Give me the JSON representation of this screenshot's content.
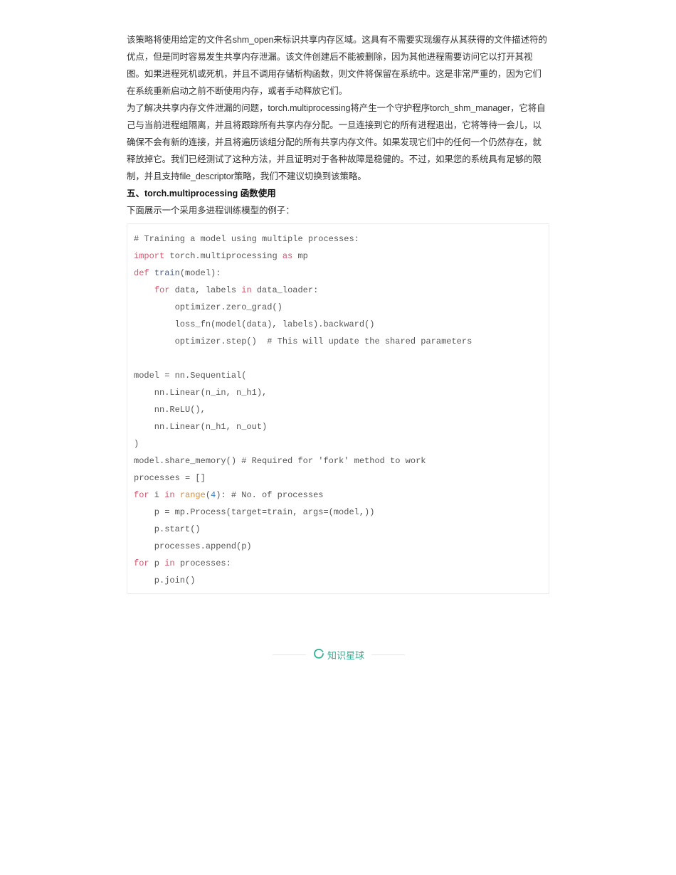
{
  "paragraphs": [
    "该策略将使用给定的文件名shm_open来标识共享内存区域。这具有不需要实现缓存从其获得的文件描述符的优点，但是同时容易发生共享内存泄漏。该文件创建后不能被删除，因为其他进程需要访问它以打开其视图。如果进程死机或死机，并且不调用存储析构函数，则文件将保留在系统中。这是非常严重的，因为它们在系统重新启动之前不断使用内存，或者手动释放它们。",
    "为了解决共享内存文件泄漏的问题，torch.multiprocessing将产生一个守护程序torch_shm_manager，它将自己与当前进程组隔离，并且将跟踪所有共享内存分配。一旦连接到它的所有进程退出，它将等待一会儿，以确保不会有新的连接，并且将遍历该组分配的所有共享内存文件。如果发现它们中的任何一个仍然存在，就释放掉它。我们已经测试了这种方法，并且证明对于各种故障是稳健的。不过，如果您的系统具有足够的限制，并且支持file_descriptor策略，我们不建议切换到该策略。"
  ],
  "section_heading": "五、torch.multiprocessing 函数使用",
  "intro_text": "下面展示一个采用多进程训练模型的例子：",
  "code": {
    "lines": [
      [
        {
          "t": "plain",
          "v": "# Training a model using multiple processes:"
        }
      ],
      [
        {
          "t": "kw",
          "v": "import"
        },
        {
          "t": "plain",
          "v": " torch.multiprocessing "
        },
        {
          "t": "kw",
          "v": "as"
        },
        {
          "t": "plain",
          "v": " mp"
        }
      ],
      [
        {
          "t": "kw",
          "v": "def"
        },
        {
          "t": "plain",
          "v": " "
        },
        {
          "t": "fn",
          "v": "train"
        },
        {
          "t": "plain",
          "v": "(model):"
        }
      ],
      [
        {
          "t": "plain",
          "v": "    "
        },
        {
          "t": "kw",
          "v": "for"
        },
        {
          "t": "plain",
          "v": " data, labels "
        },
        {
          "t": "kw",
          "v": "in"
        },
        {
          "t": "plain",
          "v": " data_loader:"
        }
      ],
      [
        {
          "t": "plain",
          "v": "        optimizer.zero_grad()"
        }
      ],
      [
        {
          "t": "plain",
          "v": "        loss_fn(model(data), labels).backward()"
        }
      ],
      [
        {
          "t": "plain",
          "v": "        optimizer.step()  # This will update the shared parameters"
        }
      ],
      [
        {
          "t": "plain",
          "v": ""
        }
      ],
      [
        {
          "t": "plain",
          "v": "model = nn.Sequential("
        }
      ],
      [
        {
          "t": "plain",
          "v": "    nn.Linear(n_in, n_h1),"
        }
      ],
      [
        {
          "t": "plain",
          "v": "    nn.ReLU(),"
        }
      ],
      [
        {
          "t": "plain",
          "v": "    nn.Linear(n_h1, n_out)"
        }
      ],
      [
        {
          "t": "plain",
          "v": ")"
        }
      ],
      [
        {
          "t": "plain",
          "v": "model.share_memory() # Required for 'fork' method to work"
        }
      ],
      [
        {
          "t": "plain",
          "v": "processes = []"
        }
      ],
      [
        {
          "t": "kw",
          "v": "for"
        },
        {
          "t": "plain",
          "v": " i "
        },
        {
          "t": "kw",
          "v": "in"
        },
        {
          "t": "plain",
          "v": " "
        },
        {
          "t": "builtin",
          "v": "range"
        },
        {
          "t": "plain",
          "v": "("
        },
        {
          "t": "num",
          "v": "4"
        },
        {
          "t": "plain",
          "v": "): # No. of processes"
        }
      ],
      [
        {
          "t": "plain",
          "v": "    p = mp.Process(target=train, args=(model,))"
        }
      ],
      [
        {
          "t": "plain",
          "v": "    p.start()"
        }
      ],
      [
        {
          "t": "plain",
          "v": "    processes.append(p)"
        }
      ],
      [
        {
          "t": "kw",
          "v": "for"
        },
        {
          "t": "plain",
          "v": " p "
        },
        {
          "t": "kw",
          "v": "in"
        },
        {
          "t": "plain",
          "v": " processes:"
        }
      ],
      [
        {
          "t": "plain",
          "v": "    p.join()"
        }
      ]
    ]
  },
  "footer": {
    "brand_label": "知识星球",
    "brand_icon": "spinner-ring-icon",
    "brand_color": "#2fb292"
  }
}
